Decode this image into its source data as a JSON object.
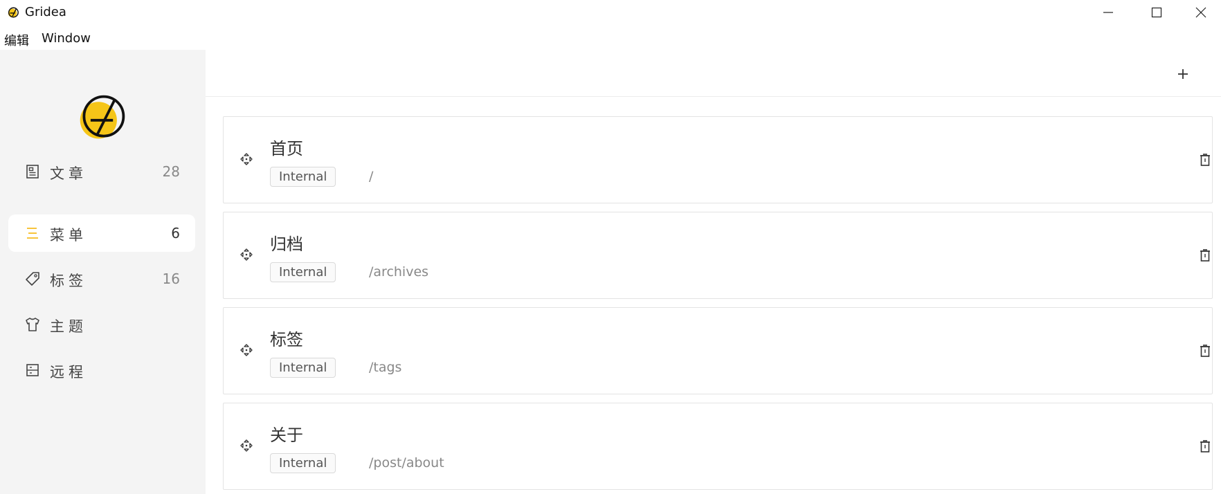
{
  "window": {
    "title": "Gridea"
  },
  "menubar": {
    "edit": "编辑",
    "window": "Window"
  },
  "sidebar": {
    "items": [
      {
        "label": "文章",
        "count": "28",
        "icon": "article-icon",
        "active": false
      },
      {
        "label": "菜单",
        "count": "6",
        "icon": "menu-icon",
        "active": true
      },
      {
        "label": "标签",
        "count": "16",
        "icon": "tag-icon",
        "active": false
      },
      {
        "label": "主题",
        "count": "",
        "icon": "shirt-icon",
        "active": false
      },
      {
        "label": "远程",
        "count": "",
        "icon": "server-icon",
        "active": false
      }
    ]
  },
  "colors": {
    "accent": "#f5c518",
    "sidebar_bg": "#f4f4f4"
  },
  "menus": [
    {
      "name": "首页",
      "type": "Internal",
      "link": "/"
    },
    {
      "name": "归档",
      "type": "Internal",
      "link": "/archives"
    },
    {
      "name": "标签",
      "type": "Internal",
      "link": "/tags"
    },
    {
      "name": "关于",
      "type": "Internal",
      "link": "/post/about"
    }
  ]
}
